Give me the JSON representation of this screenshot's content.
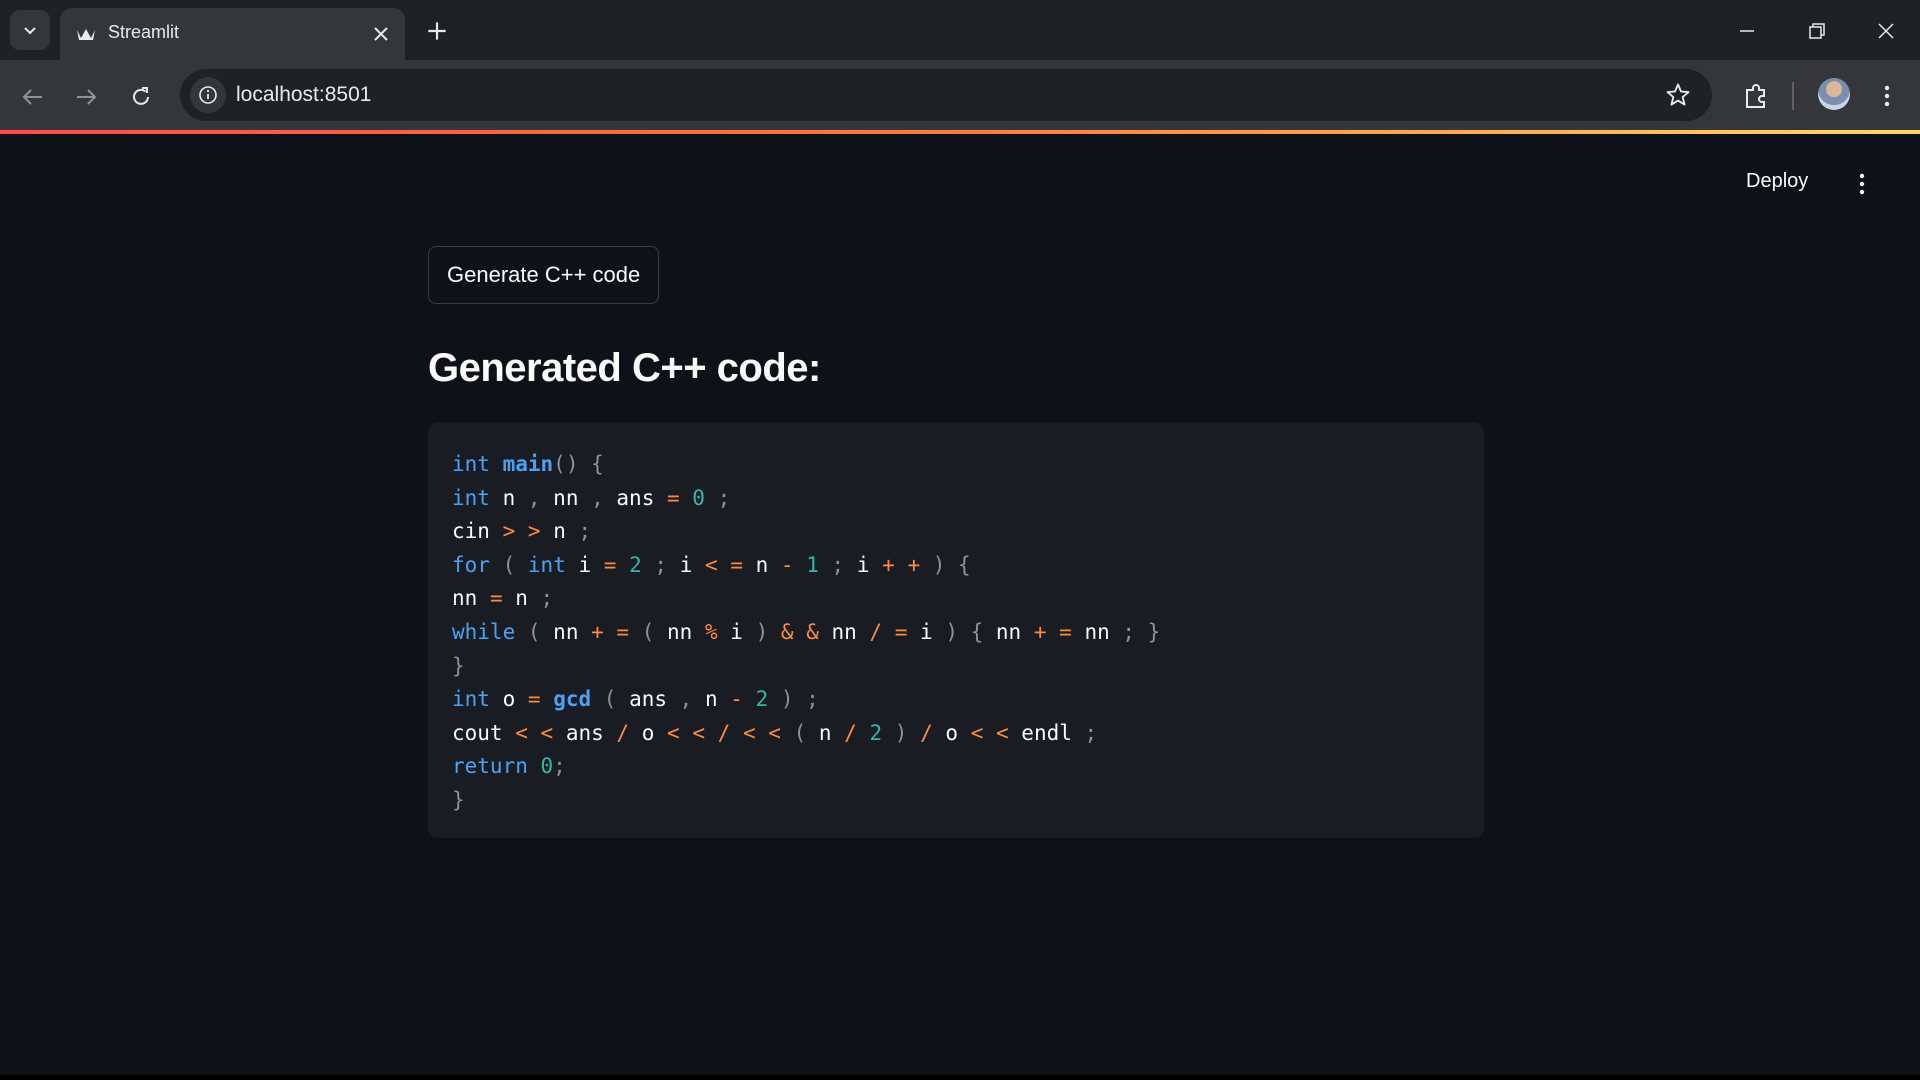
{
  "browser": {
    "tab_title": "Streamlit",
    "url": "localhost:8501",
    "accent_gradient": [
      "#ff4b4b",
      "#ff7a3d",
      "#ffd766"
    ]
  },
  "app": {
    "deploy_label": "Deploy",
    "generate_button_label": "Generate C++ code",
    "heading": "Generated C++ code:",
    "code_lines": [
      [
        [
          "kw",
          "int"
        ],
        [
          "id",
          " "
        ],
        [
          "fn",
          "main"
        ],
        [
          "punc",
          "() {"
        ]
      ],
      [
        [
          "kw",
          "int"
        ],
        [
          "id",
          " n "
        ],
        [
          "punc",
          ","
        ],
        [
          "id",
          " nn "
        ],
        [
          "punc",
          ","
        ],
        [
          "id",
          " ans "
        ],
        [
          "op",
          "="
        ],
        [
          "id",
          " "
        ],
        [
          "num",
          "0"
        ],
        [
          "id",
          " "
        ],
        [
          "punc",
          ";"
        ]
      ],
      [
        [
          "id",
          "cin "
        ],
        [
          "op",
          ">"
        ],
        [
          "id",
          " "
        ],
        [
          "op",
          ">"
        ],
        [
          "id",
          " n "
        ],
        [
          "punc",
          ";"
        ]
      ],
      [
        [
          "kw",
          "for"
        ],
        [
          "id",
          " "
        ],
        [
          "punc",
          "("
        ],
        [
          "id",
          " "
        ],
        [
          "kw",
          "int"
        ],
        [
          "id",
          " i "
        ],
        [
          "op",
          "="
        ],
        [
          "id",
          " "
        ],
        [
          "num",
          "2"
        ],
        [
          "id",
          " "
        ],
        [
          "punc",
          ";"
        ],
        [
          "id",
          " i "
        ],
        [
          "op",
          "<"
        ],
        [
          "id",
          " "
        ],
        [
          "op",
          "="
        ],
        [
          "id",
          " n "
        ],
        [
          "op",
          "-"
        ],
        [
          "id",
          " "
        ],
        [
          "num",
          "1"
        ],
        [
          "id",
          " "
        ],
        [
          "punc",
          ";"
        ],
        [
          "id",
          " i "
        ],
        [
          "op",
          "+"
        ],
        [
          "id",
          " "
        ],
        [
          "op",
          "+"
        ],
        [
          "id",
          " "
        ],
        [
          "punc",
          ") {"
        ]
      ],
      [
        [
          "id",
          "nn "
        ],
        [
          "op",
          "="
        ],
        [
          "id",
          " n "
        ],
        [
          "punc",
          ";"
        ]
      ],
      [
        [
          "kw",
          "while"
        ],
        [
          "id",
          " "
        ],
        [
          "punc",
          "("
        ],
        [
          "id",
          " nn "
        ],
        [
          "op",
          "+"
        ],
        [
          "id",
          " "
        ],
        [
          "op",
          "="
        ],
        [
          "id",
          " "
        ],
        [
          "punc",
          "("
        ],
        [
          "id",
          " nn "
        ],
        [
          "op",
          "%"
        ],
        [
          "id",
          " i "
        ],
        [
          "punc",
          ")"
        ],
        [
          "id",
          " "
        ],
        [
          "op",
          "&"
        ],
        [
          "id",
          " "
        ],
        [
          "op",
          "&"
        ],
        [
          "id",
          " nn "
        ],
        [
          "op",
          "/"
        ],
        [
          "id",
          " "
        ],
        [
          "op",
          "="
        ],
        [
          "id",
          " i "
        ],
        [
          "punc",
          ") {"
        ],
        [
          "id",
          " nn "
        ],
        [
          "op",
          "+"
        ],
        [
          "id",
          " "
        ],
        [
          "op",
          "="
        ],
        [
          "id",
          " nn "
        ],
        [
          "punc",
          "; }"
        ]
      ],
      [
        [
          "punc",
          "}"
        ]
      ],
      [
        [
          "kw",
          "int"
        ],
        [
          "id",
          " o "
        ],
        [
          "op",
          "="
        ],
        [
          "id",
          " "
        ],
        [
          "fn",
          "gcd"
        ],
        [
          "id",
          " "
        ],
        [
          "punc",
          "("
        ],
        [
          "id",
          " ans "
        ],
        [
          "punc",
          ","
        ],
        [
          "id",
          " n "
        ],
        [
          "op",
          "-"
        ],
        [
          "id",
          " "
        ],
        [
          "num",
          "2"
        ],
        [
          "id",
          " "
        ],
        [
          "punc",
          ") ;"
        ]
      ],
      [
        [
          "id",
          "cout "
        ],
        [
          "op",
          "<"
        ],
        [
          "id",
          " "
        ],
        [
          "op",
          "<"
        ],
        [
          "id",
          " ans "
        ],
        [
          "op",
          "/"
        ],
        [
          "id",
          " o "
        ],
        [
          "op",
          "<"
        ],
        [
          "id",
          " "
        ],
        [
          "op",
          "<"
        ],
        [
          "id",
          " "
        ],
        [
          "op",
          "/"
        ],
        [
          "id",
          " "
        ],
        [
          "op",
          "<"
        ],
        [
          "id",
          " "
        ],
        [
          "op",
          "<"
        ],
        [
          "id",
          " "
        ],
        [
          "punc",
          "("
        ],
        [
          "id",
          " n "
        ],
        [
          "op",
          "/"
        ],
        [
          "id",
          " "
        ],
        [
          "num",
          "2"
        ],
        [
          "id",
          " "
        ],
        [
          "punc",
          ")"
        ],
        [
          "id",
          " "
        ],
        [
          "op",
          "/"
        ],
        [
          "id",
          " o "
        ],
        [
          "op",
          "<"
        ],
        [
          "id",
          " "
        ],
        [
          "op",
          "<"
        ],
        [
          "id",
          " endl "
        ],
        [
          "punc",
          ";"
        ]
      ],
      [
        [
          "kw",
          "return"
        ],
        [
          "id",
          " "
        ],
        [
          "num",
          "0"
        ],
        [
          "punc",
          ";"
        ]
      ],
      [
        [
          "punc",
          "}"
        ]
      ]
    ]
  }
}
